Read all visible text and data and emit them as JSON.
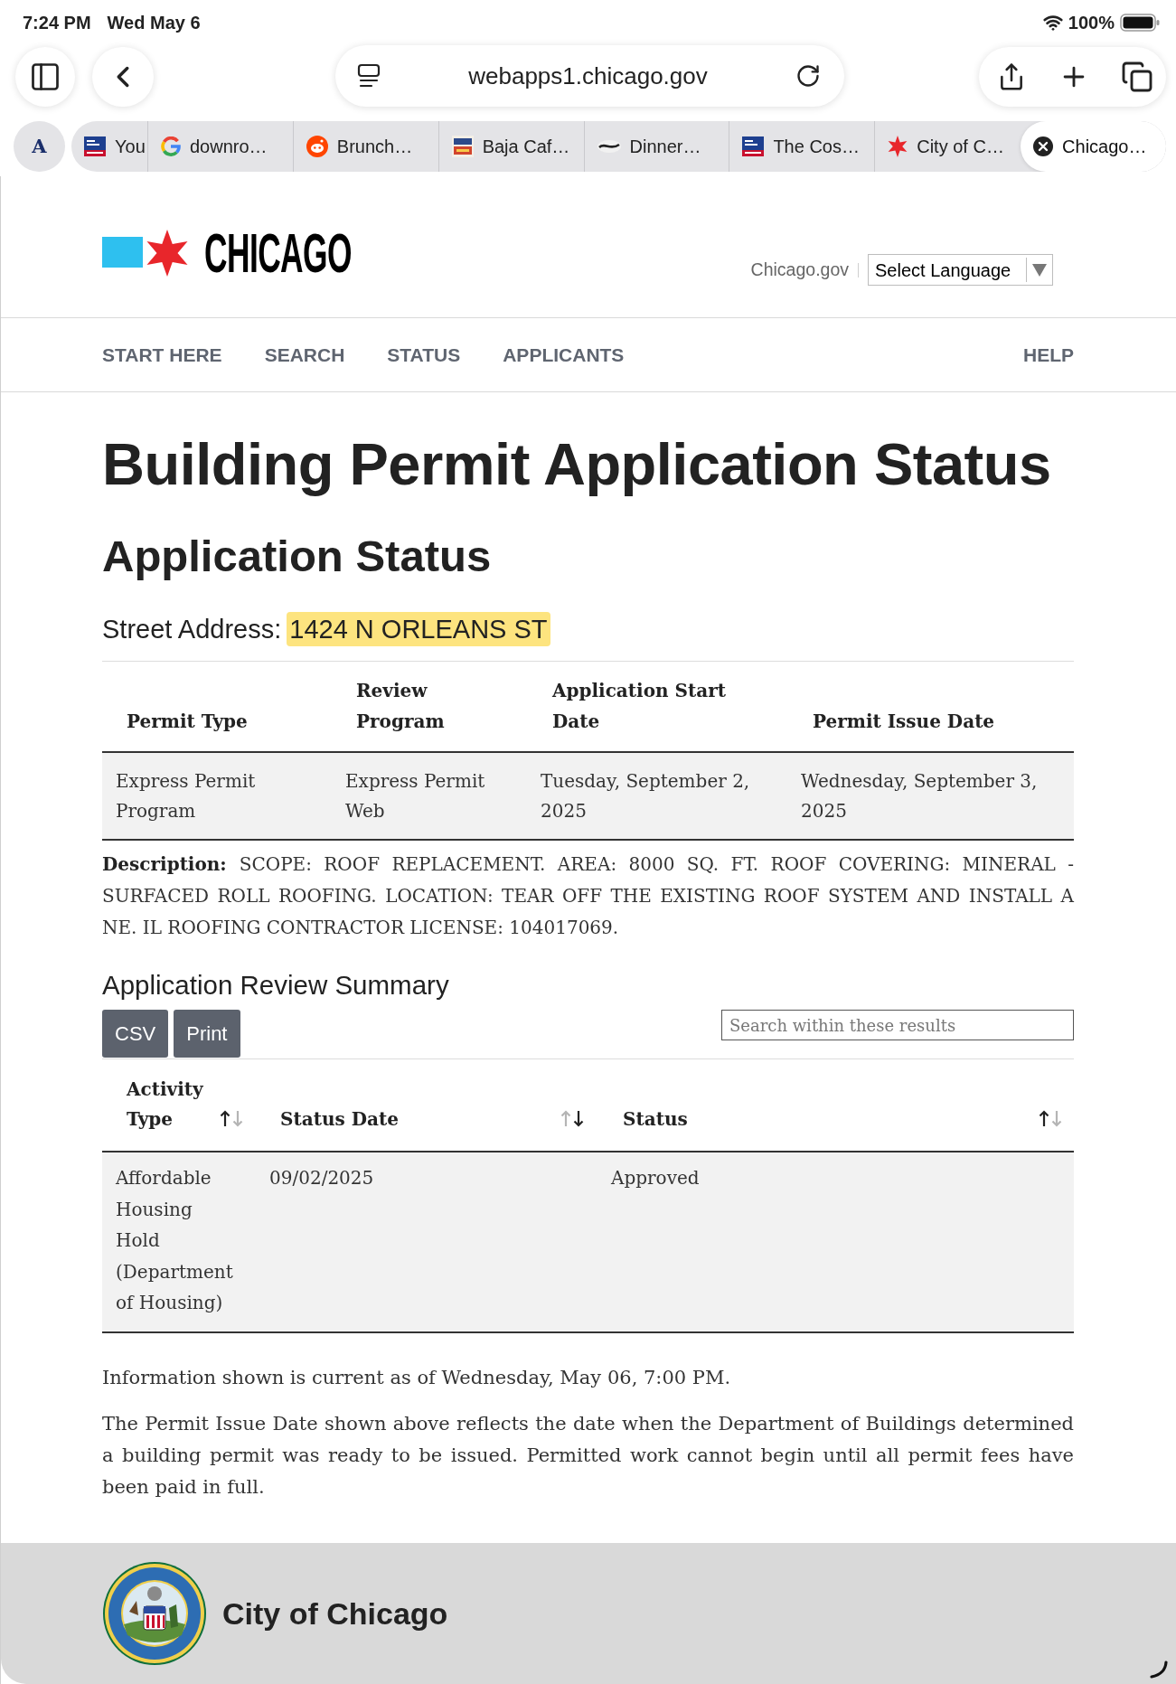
{
  "status_bar": {
    "time": "7:24 PM",
    "date": "Wed May 6",
    "battery": "100%"
  },
  "toolbar": {
    "address": "webapps1.chicago.gov"
  },
  "tab_bar": {
    "group_label": "A",
    "tabs": [
      {
        "title": "You",
        "kind": "news",
        "selected": false
      },
      {
        "title": "downro…",
        "kind": "g",
        "selected": false
      },
      {
        "title": "Brunch…",
        "kind": "face",
        "selected": false
      },
      {
        "title": "Baja Caf…",
        "kind": "cafe",
        "selected": false
      },
      {
        "title": "Dinner…",
        "kind": "swoosh",
        "selected": false
      },
      {
        "title": "The Cos…",
        "kind": "news",
        "selected": false
      },
      {
        "title": "City of C…",
        "kind": "star",
        "selected": false
      },
      {
        "title": "Chicago…",
        "selected": true
      }
    ]
  },
  "header": {
    "logo_text": "CHICAGO",
    "site_link": "Chicago.gov",
    "language_select": {
      "value": "Select Language"
    }
  },
  "nav": {
    "items": [
      "START HERE",
      "SEARCH",
      "STATUS",
      "APPLICANTS"
    ],
    "help": "HELP"
  },
  "page": {
    "title": "Building Permit Application Status",
    "subtitle": "Application Status",
    "address": {
      "label": "Street Address:",
      "value": "1424 N ORLEANS ST",
      "highlighted": true
    }
  },
  "permit_table": {
    "columns": [
      "Permit Type",
      "Review Program",
      "Application Start Date",
      "Permit Issue Date"
    ],
    "rows": [
      [
        "Express Permit Program",
        "Express Permit Web",
        "Tuesday, September 2, 2025",
        "Wednesday, September 3, 2025"
      ]
    ]
  },
  "description": {
    "label": "Description:",
    "text": "SCOPE: ROOF REPLACEMENT. AREA: 8000 SQ. FT. ROOF COVERING: MINERAL - SURFACED ROLL ROOFING. LOCATION: TEAR OFF THE EXISTING ROOF SYSTEM AND INSTALL A NE. IL ROOFING CONTRACTOR LICENSE: 104017069."
  },
  "review": {
    "title": "Application Review Summary",
    "buttons": [
      "CSV",
      "Print"
    ],
    "search": {
      "placeholder": "Search within these results"
    },
    "columns": [
      {
        "label": "Activity Type",
        "ascending": true
      },
      {
        "label": "Status Date",
        "ascending": false
      },
      {
        "label": "Status",
        "ascending": true
      }
    ],
    "rows": [
      [
        "Affordable Housing Hold (Department of Housing)",
        "09/02/2025",
        "Approved"
      ]
    ]
  },
  "notes": [
    "Information shown is current as of Wednesday, May 06, 7:00 PM.",
    "The Permit Issue Date shown above reflects the date when the Department of Buildings determined a building permit was ready to be issued. Permitted work cannot begin until all permit fees have been paid in full."
  ],
  "footer": {
    "title": "City of Chicago"
  }
}
